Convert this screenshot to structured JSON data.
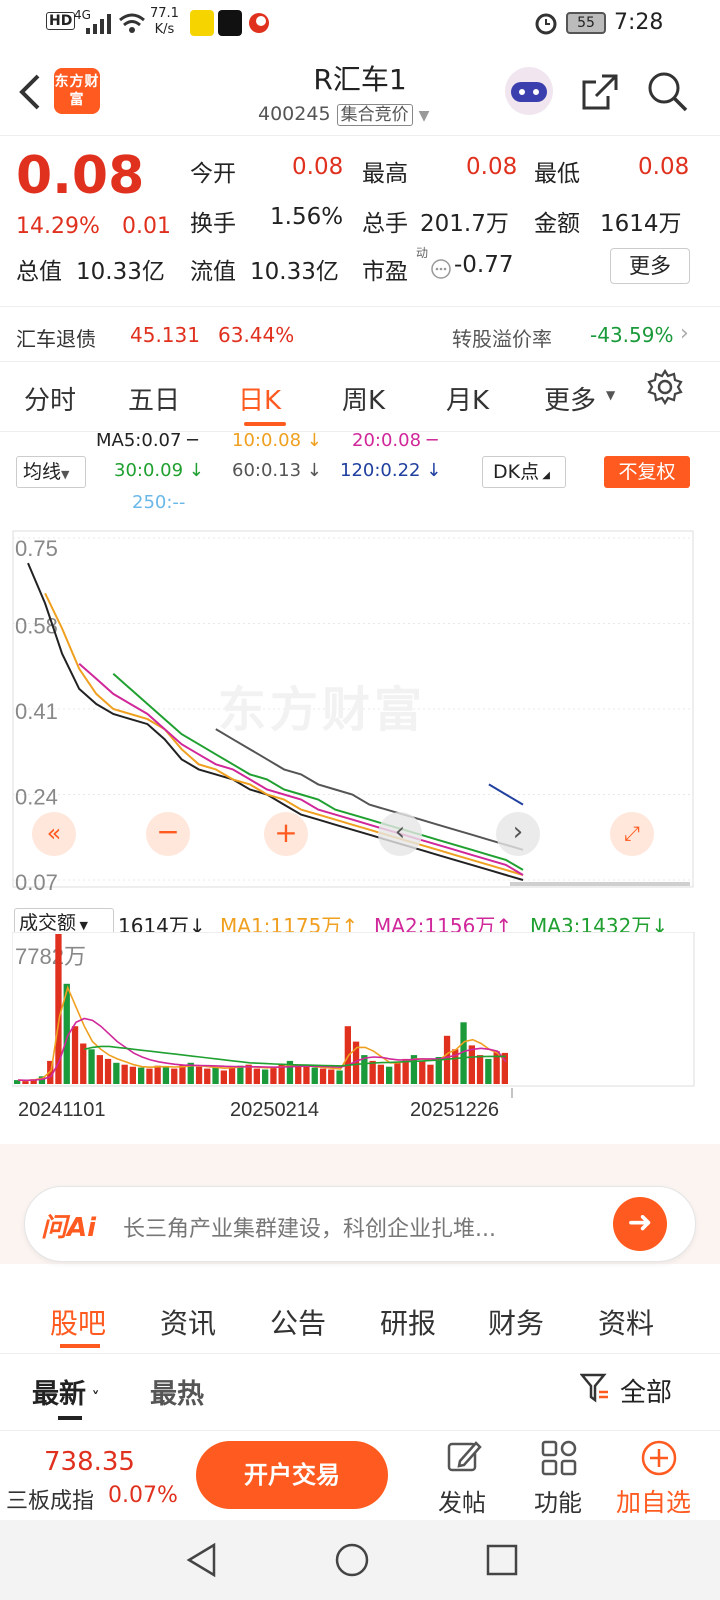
{
  "status": {
    "time": "7:28",
    "speed": "77.1",
    "speed_unit": "K/s",
    "net": "4G",
    "battery": "55",
    "hd": "HD"
  },
  "header": {
    "logo": "东方财富",
    "title": "R汇车1",
    "code": "400245",
    "market": "集合竞价"
  },
  "quote": {
    "price": "0.08",
    "change_pct": "14.29%",
    "change": "0.01",
    "open_label": "今开",
    "open": "0.08",
    "high_label": "最高",
    "high": "0.08",
    "low_label": "最低",
    "low": "0.08",
    "turnover_label": "换手",
    "turnover": "1.56%",
    "hands_label": "总手",
    "hands": "201.7万",
    "amount_label": "金额",
    "amount": "1614万",
    "mktcap_label": "总值",
    "mktcap": "10.33亿",
    "float_label": "流值",
    "float": "10.33亿",
    "pe_label": "市盈",
    "pe_dyn": "动",
    "pe": "-0.77",
    "more": "更多"
  },
  "bond": {
    "name": "汇车退债",
    "price": "45.131",
    "pct": "63.44%",
    "premium_label": "转股溢价率",
    "premium": "-43.59%"
  },
  "tabs": [
    "分时",
    "五日",
    "日K",
    "周K",
    "月K",
    "更多"
  ],
  "active_tab": 2,
  "ma": {
    "selector": "均线",
    "ma5": "MA5:0.07",
    "ma10": "10:0.08",
    "ma20": "20:0.08",
    "ma30": "30:0.09",
    "ma60": "60:0.13",
    "ma120": "120:0.22",
    "ma250": "250:--",
    "dk": "DK点",
    "fq": "不复权"
  },
  "colors": {
    "accent": "#ff5a1f",
    "up": "#e0301e",
    "down": "#1a9a3a",
    "ma5": "#222222",
    "ma10": "#f0a020",
    "ma20": "#d0289a",
    "ma30": "#20a030",
    "ma60": "#555555",
    "ma120": "#2040a0"
  },
  "chart_data": [
    {
      "type": "line",
      "title": "",
      "y_ticks": [
        "0.75",
        "0.58",
        "0.41",
        "0.24",
        "0.07"
      ],
      "ylim": [
        0.07,
        0.75
      ],
      "watermark": "东方财富",
      "series": [
        {
          "name": "MA5",
          "values": [
            0.7,
            0.62,
            0.52,
            0.45,
            0.42,
            0.4,
            0.39,
            0.38,
            0.35,
            0.31,
            0.29,
            0.28,
            0.27,
            0.25,
            0.24,
            0.22,
            0.2,
            0.19,
            0.18,
            0.17,
            0.16,
            0.15,
            0.14,
            0.13,
            0.12,
            0.11,
            0.1,
            0.09,
            0.08,
            0.07
          ]
        },
        {
          "name": "MA10",
          "values": [
            null,
            0.64,
            0.57,
            0.49,
            0.44,
            0.41,
            0.4,
            0.39,
            0.37,
            0.33,
            0.3,
            0.29,
            0.27,
            0.26,
            0.24,
            0.23,
            0.21,
            0.2,
            0.19,
            0.18,
            0.17,
            0.16,
            0.15,
            0.14,
            0.13,
            0.12,
            0.11,
            0.1,
            0.09,
            0.08
          ]
        },
        {
          "name": "MA20",
          "values": [
            null,
            null,
            null,
            0.5,
            0.47,
            0.44,
            0.42,
            0.4,
            0.37,
            0.34,
            0.32,
            0.3,
            0.29,
            0.27,
            0.25,
            0.24,
            0.23,
            0.21,
            0.2,
            0.19,
            0.18,
            0.17,
            0.16,
            0.15,
            0.14,
            0.13,
            0.12,
            0.11,
            0.1,
            0.08
          ]
        },
        {
          "name": "MA30",
          "values": [
            null,
            null,
            null,
            null,
            null,
            0.48,
            0.45,
            0.42,
            0.39,
            0.36,
            0.34,
            0.32,
            0.3,
            0.28,
            0.27,
            0.25,
            0.24,
            0.23,
            0.21,
            0.2,
            0.19,
            0.18,
            0.17,
            0.16,
            0.15,
            0.14,
            0.13,
            0.12,
            0.11,
            0.09
          ]
        },
        {
          "name": "MA60",
          "values": [
            null,
            null,
            null,
            null,
            null,
            null,
            null,
            null,
            null,
            null,
            null,
            0.37,
            0.35,
            0.33,
            0.31,
            0.29,
            0.28,
            0.26,
            0.25,
            0.24,
            0.22,
            0.21,
            0.2,
            0.19,
            0.18,
            0.17,
            0.16,
            0.15,
            0.14,
            0.13
          ]
        },
        {
          "name": "MA120",
          "values": [
            null,
            null,
            null,
            null,
            null,
            null,
            null,
            null,
            null,
            null,
            null,
            null,
            null,
            null,
            null,
            null,
            null,
            null,
            null,
            null,
            null,
            null,
            null,
            null,
            null,
            null,
            null,
            0.26,
            0.24,
            0.22
          ]
        }
      ]
    },
    {
      "type": "bar",
      "title": "",
      "y_ticks": [
        "7782万"
      ],
      "x_ticks": [
        "20241101",
        "20250214",
        "20251226"
      ],
      "ylim": [
        0,
        7782
      ],
      "series": [
        {
          "name": "成交额",
          "values": [
            200,
            150,
            250,
            400,
            1200,
            7782,
            5200,
            3000,
            2100,
            1800,
            1500,
            1300,
            1100,
            1000,
            900,
            850,
            800,
            950,
            900,
            800,
            1000,
            1100,
            900,
            800,
            850,
            700,
            900,
            950,
            1000,
            800,
            750,
            900,
            1000,
            1200,
            950,
            900,
            850,
            800,
            750,
            700,
            3000,
            2200,
            1500,
            1200,
            1000,
            900,
            1100,
            1300,
            1500,
            1200,
            1000,
            1400,
            2500,
            1800,
            3200,
            2000,
            1500,
            1300,
            1700,
            1614
          ]
        }
      ],
      "ma_lines": [
        {
          "name": "MA1",
          "values": [
            200,
            180,
            220,
            300,
            700,
            3500,
            5000,
            4000,
            3000,
            2200,
            1800,
            1500,
            1300,
            1150,
            1000,
            900,
            870,
            900,
            900,
            880,
            900,
            950,
            950,
            900,
            860,
            820,
            850,
            880,
            900,
            870,
            840,
            860,
            900,
            950,
            980,
            950,
            900,
            860,
            820,
            780,
            1500,
            1900,
            1900,
            1700,
            1400,
            1100,
            1100,
            1200,
            1300,
            1300,
            1250,
            1250,
            1600,
            1800,
            2200,
            2300,
            2100,
            1800,
            1600,
            1175
          ]
        },
        {
          "name": "MA2",
          "values": [
            200,
            190,
            210,
            250,
            400,
            1200,
            2500,
            3200,
            3400,
            3300,
            3000,
            2600,
            2200,
            1900,
            1600,
            1400,
            1250,
            1150,
            1080,
            1020,
            980,
            970,
            960,
            950,
            940,
            920,
            910,
            900,
            900,
            890,
            880,
            870,
            880,
            900,
            920,
            930,
            920,
            910,
            890,
            870,
            1000,
            1200,
            1350,
            1400,
            1380,
            1300,
            1250,
            1250,
            1280,
            1300,
            1300,
            1290,
            1400,
            1500,
            1700,
            1800,
            1850,
            1800,
            1700,
            1156
          ]
        },
        {
          "name": "MA3",
          "values": [
            null,
            null,
            null,
            null,
            null,
            null,
            null,
            null,
            1800,
            1900,
            1950,
            1950,
            1900,
            1850,
            1800,
            1750,
            1700,
            1650,
            1600,
            1550,
            1500,
            1450,
            1400,
            1350,
            1300,
            1250,
            1200,
            1150,
            1100,
            1080,
            1060,
            1040,
            1020,
            1000,
            990,
            980,
            970,
            960,
            950,
            940,
            980,
            1020,
            1060,
            1090,
            1110,
            1120,
            1140,
            1160,
            1180,
            1200,
            1220,
            1250,
            1290,
            1330,
            1370,
            1400,
            1420,
            1430,
            1432,
            1432
          ]
        }
      ]
    }
  ],
  "vol_header": {
    "selector": "成交额",
    "value": "1614万",
    "ma1": "MA1:1175万",
    "ma2": "MA2:1156万",
    "ma3": "MA3:1432万"
  },
  "ai": {
    "label": "问Ai",
    "text": "长三角产业集群建设，科创企业扎堆..."
  },
  "section_tabs": [
    "股吧",
    "资讯",
    "公告",
    "研报",
    "财务",
    "资料"
  ],
  "sort": {
    "latest": "最新",
    "hot": "最热",
    "filter": "全部"
  },
  "bottom": {
    "index_value": "738.35",
    "index_name": "三板成指",
    "index_pct": "0.07%",
    "trade": "开户交易",
    "post": "发帖",
    "func": "功能",
    "add": "加自选"
  }
}
